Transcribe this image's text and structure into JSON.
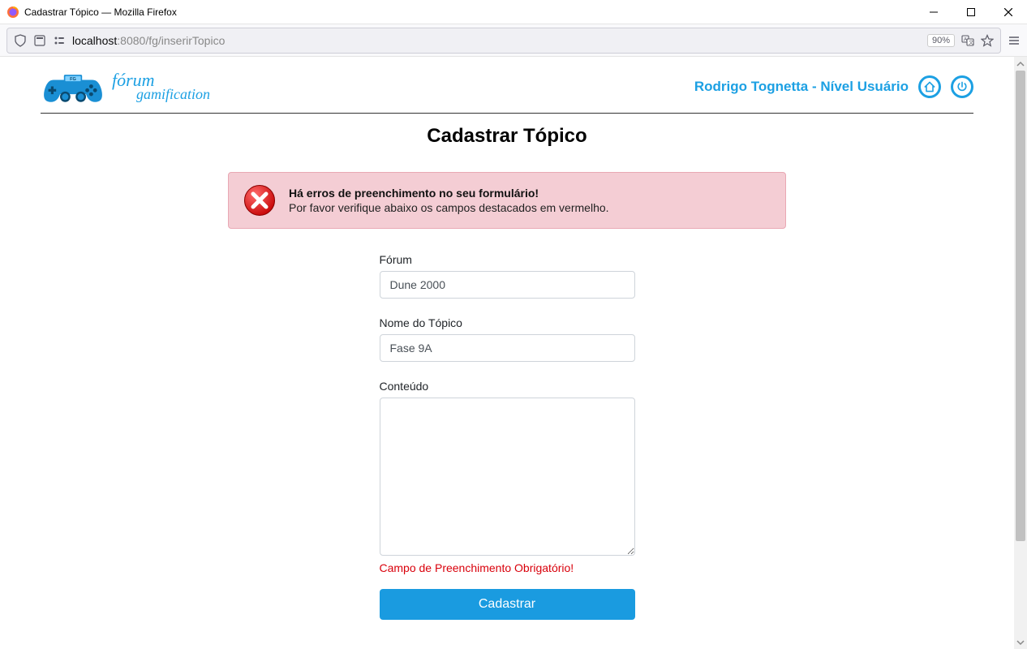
{
  "window": {
    "title": "Cadastrar Tópico — Mozilla Firefox"
  },
  "addressbar": {
    "host": "localhost",
    "port": ":8080",
    "path": "/fg/inserirTopico",
    "zoom": "90%"
  },
  "header": {
    "logo_line1": "fórum",
    "logo_line2": "gamification",
    "user_label": "Rodrigo Tognetta - Nível Usuário"
  },
  "page_title": "Cadastrar Tópico",
  "alert": {
    "title": "Há erros de preenchimento no seu formulário!",
    "subtitle": "Por favor verifique abaixo os campos destacados em vermelho."
  },
  "form": {
    "forum_label": "Fórum",
    "forum_value": "Dune 2000",
    "topic_label": "Nome do Tópico",
    "topic_value": "Fase 9A",
    "content_label": "Conteúdo",
    "content_value": "",
    "content_error": "Campo de Preenchimento Obrigatório!",
    "submit_label": "Cadastrar"
  }
}
